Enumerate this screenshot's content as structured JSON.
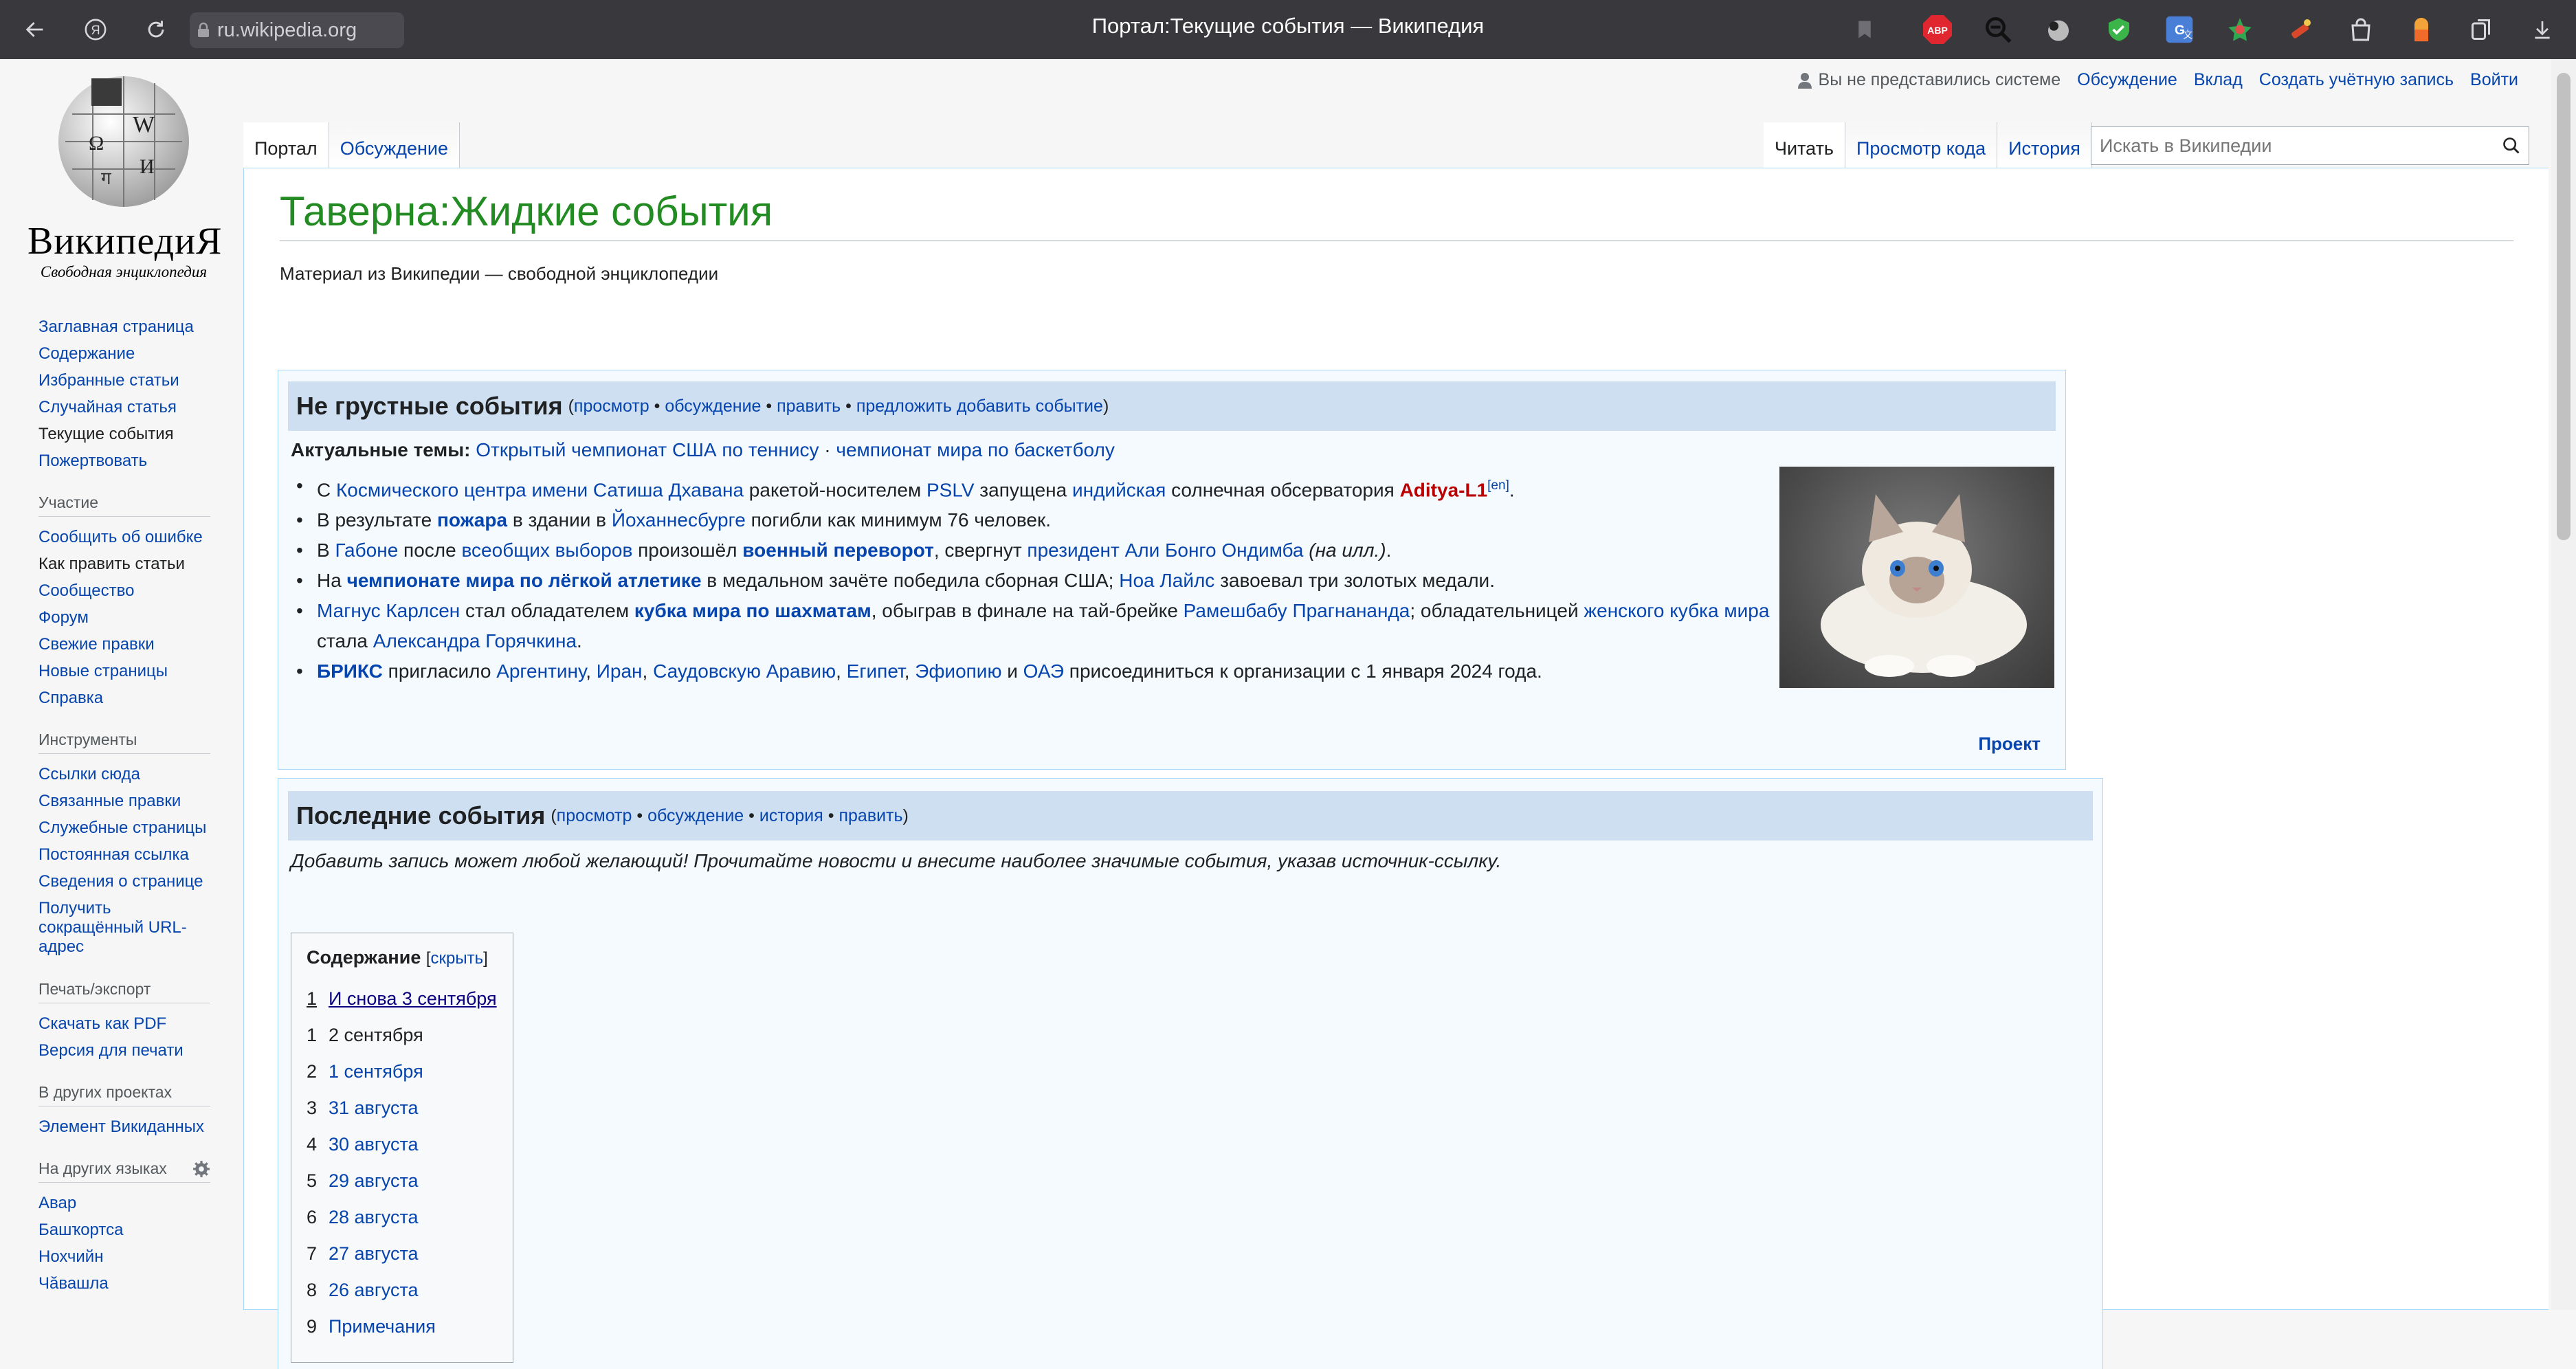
{
  "browser": {
    "url": "ru.wikipedia.org",
    "tab_title": "Портал:Текущие события — Википедия"
  },
  "logo": {
    "wordmark": "ВикипедиЯ",
    "tagline": "Свободная энциклопедия"
  },
  "personal": {
    "not_logged": "Вы не представились системе",
    "talk": "Обсуждение",
    "contributions": "Вклад",
    "create_account": "Создать учётную запись",
    "login": "Войти"
  },
  "tabs": {
    "portal": "Портал",
    "discussion": "Обсуждение",
    "read": "Читать",
    "view_source": "Просмотр кода",
    "history": "История"
  },
  "search": {
    "placeholder": "Искать в Википедии"
  },
  "heading": "Таверна:Жидкие события",
  "site_sub": "Материал из Википедии — свободной энциклопедии",
  "sidebar": {
    "nav": [
      "Заглавная страница",
      "Содержание",
      "Избранные статьи",
      "Случайная статья",
      "Текущие события",
      "Пожертвовать"
    ],
    "participation_title": "Участие",
    "participation": [
      "Сообщить об ошибке",
      "Как править статьи",
      "Сообщество",
      "Форум",
      "Свежие правки",
      "Новые страницы",
      "Справка"
    ],
    "tools_title": "Инструменты",
    "tools": [
      "Ссылки сюда",
      "Связанные правки",
      "Служебные страницы",
      "Постоянная ссылка",
      "Сведения о странице",
      "Получить сокращённый URL-адрес"
    ],
    "print_title": "Печать/экспорт",
    "print": [
      "Скачать как PDF",
      "Версия для печати"
    ],
    "projects_title": "В других проектах",
    "projects": [
      "Элемент Викиданных"
    ],
    "langs_title": "На других языках",
    "langs": [
      "Авар",
      "Башҡортса",
      "Нохчийн",
      "Чăвашла"
    ]
  },
  "box1": {
    "title": "Не грустные события",
    "links": {
      "view": "просмотр",
      "discuss": "обсуждение",
      "edit": "править",
      "suggest": "предложить добавить событие"
    },
    "topics_label": "Актуальные темы:",
    "topic1": "Открытый чемпионат США по теннису",
    "topic2": "чемпионат мира по баскетболу",
    "n1": {
      "a": "С ",
      "b": "Космического центра имени Сатиша Дхавана",
      "c": " ракетой-носителем ",
      "d": "PSLV",
      "e": " запущена ",
      "f": "индийская",
      "g": " солнечная обсерватория ",
      "h": "Aditya-L1",
      "i": "[en]",
      "j": "."
    },
    "n2": {
      "a": "В результате ",
      "b": "пожара",
      "c": " в здании в ",
      "d": "Йоханнесбурге",
      "e": " погибли как минимум 76 человек."
    },
    "n3": {
      "a": "В ",
      "b": "Габоне",
      "c": " после ",
      "d": "всеобщих выборов",
      "e": " произошёл ",
      "f": "военный переворот",
      "g": ", свергнут ",
      "h": "президент Али Бонго Ондимба",
      "i": " (на илл.)",
      "j": "."
    },
    "n4": {
      "a": "На ",
      "b": "чемпионате мира по лёгкой атлетике",
      "c": " в медальном зачёте победила сборная США; ",
      "d": "Ноа Лайлс",
      "e": " завоевал три золотых медали."
    },
    "n5": {
      "a": "Магнус Карлсен",
      "b": " стал обладателем ",
      "c": "кубка мира по шахматам",
      "d": ", обыграв в финале на тай-брейке ",
      "e": "Рамешбабу Прагнананда",
      "f": "; обладательницей ",
      "g": "женского кубка мира",
      "h": " стала ",
      "i": "Александра Горячкина",
      "j": "."
    },
    "n6": {
      "a": "БРИКС",
      "b": " пригласило ",
      "c": "Аргентину",
      "d": ", ",
      "e": "Иран",
      "f": ", ",
      "g": "Саудовскую Аравию",
      "h": ", ",
      "i": "Египет",
      "j": ", ",
      "k": "Эфиопию",
      "l": " и ",
      "m": "ОАЭ",
      "n": " присоединиться к организации с 1 января 2024 года."
    },
    "project": "Проект"
  },
  "box2": {
    "title": "Последние события",
    "links": {
      "view": "просмотр",
      "discuss": "обсуждение",
      "history": "история",
      "edit": "править"
    },
    "intro": "Добавить запись может любой желающий! Прочитайте новости и внесите наиболее значимые события, указав источник-ссылку."
  },
  "toc": {
    "title": "Содержание",
    "hide": "скрыть",
    "items": [
      {
        "n": "1",
        "t": "И снова 3 сентября"
      },
      {
        "n": "1",
        "t": "2 сентября"
      },
      {
        "n": "2",
        "t": "1 сентября"
      },
      {
        "n": "3",
        "t": "31 августа"
      },
      {
        "n": "4",
        "t": "30 августа"
      },
      {
        "n": "5",
        "t": "29 августа"
      },
      {
        "n": "6",
        "t": "28 августа"
      },
      {
        "n": "7",
        "t": "27 августа"
      },
      {
        "n": "8",
        "t": "26 августа"
      },
      {
        "n": "9",
        "t": "Примечания"
      }
    ]
  },
  "colors": {
    "link": "#0645ad",
    "heading": "#228b22",
    "box_head": "#cedff2",
    "red_link": "#ba0000"
  }
}
